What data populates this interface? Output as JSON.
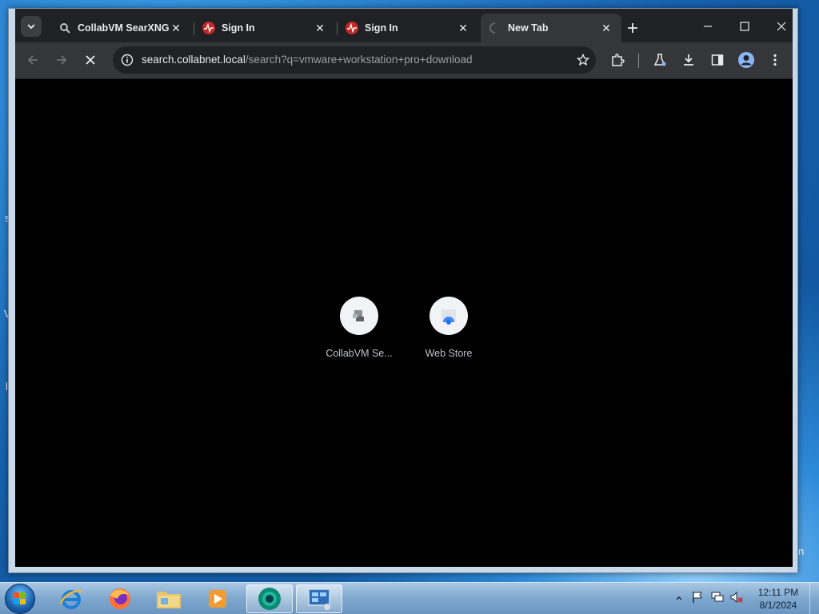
{
  "browser": {
    "tabs": [
      {
        "title": "CollabVM SearXNG",
        "favicon": "searxng-icon",
        "active": false
      },
      {
        "title": "Sign In",
        "favicon": "pulse-icon",
        "active": false
      },
      {
        "title": "Sign In",
        "favicon": "pulse-icon",
        "active": false
      },
      {
        "title": "New Tab",
        "favicon": "loading-spinner-icon",
        "active": true
      }
    ],
    "address": {
      "host": "search.collabnet.local",
      "path": "/search?q=vmware+workstation+pro+download"
    },
    "shortcuts": [
      {
        "label": "CollabVM Se...",
        "icon": "collabvm-icon"
      },
      {
        "label": "Web Store",
        "icon": "web-store-icon"
      }
    ]
  },
  "taskbar": {
    "apps": [
      "internet-explorer-icon",
      "firefox-icon",
      "file-explorer-icon",
      "media-player-icon",
      "chrome-icon",
      "control-panel-icon"
    ],
    "clock": {
      "time": "12:11 PM",
      "date": "8/1/2024"
    }
  },
  "desktop": {
    "fragments": [
      "s",
      "V",
      "l",
      "n"
    ]
  },
  "colors": {
    "accent_red": "#c62828",
    "toolbar": "#35363a",
    "tabstrip": "#202124"
  }
}
